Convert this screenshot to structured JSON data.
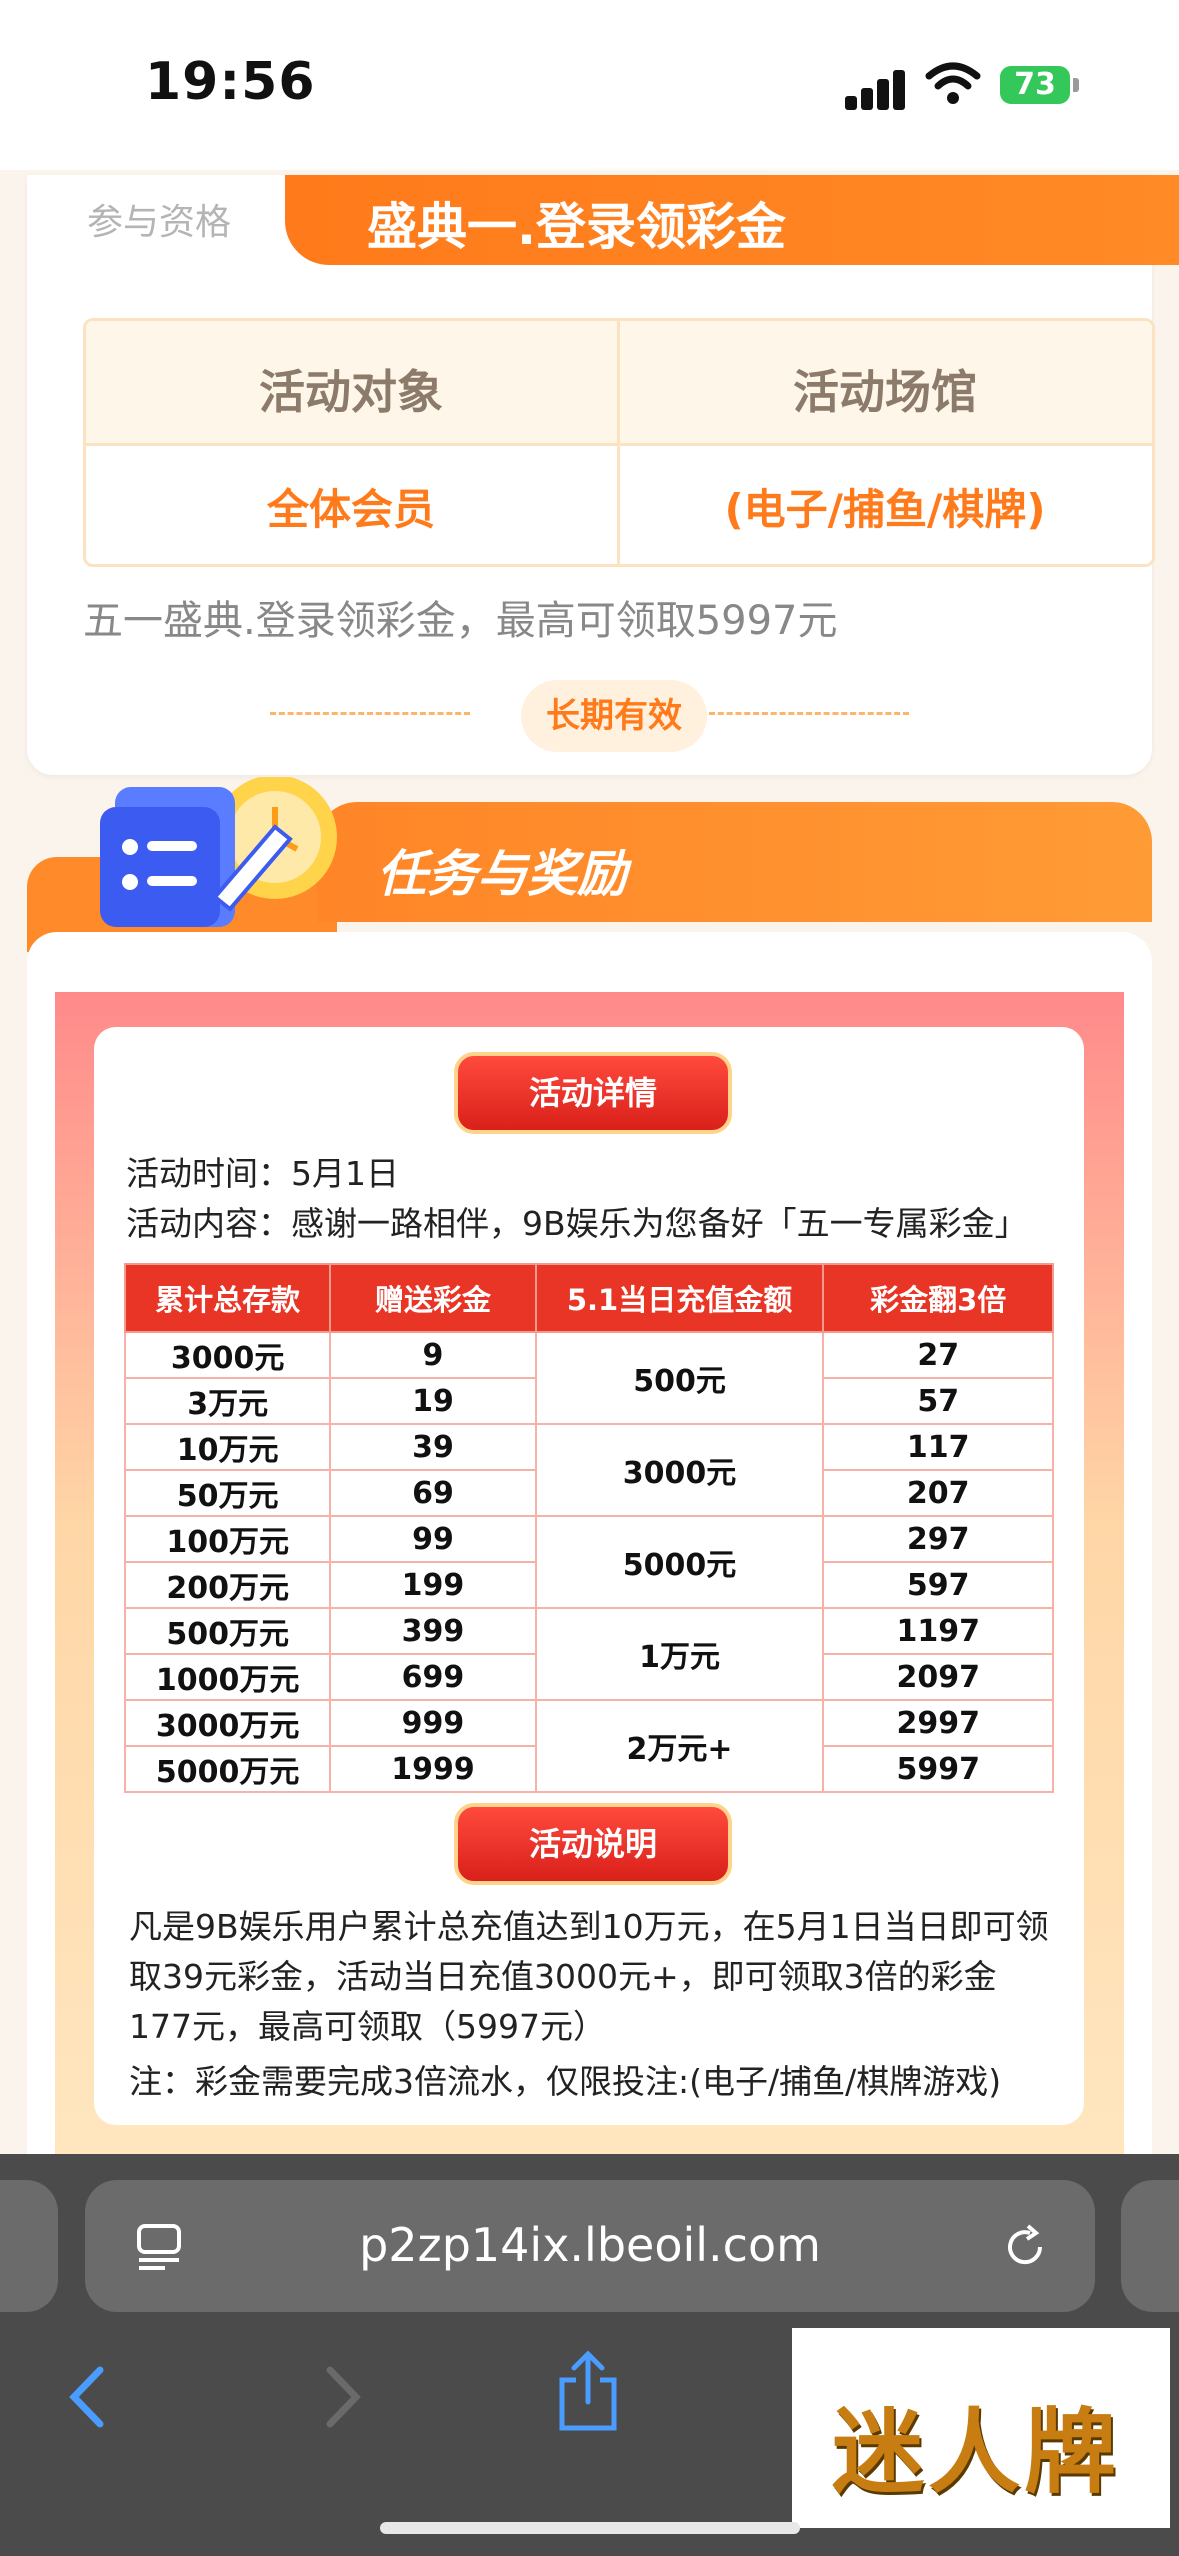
{
  "status": {
    "time": "19:56",
    "battery": "73"
  },
  "top_card": {
    "tab_label": "参与资格",
    "banner_title": "盛典一.登录领彩金",
    "table_headers": [
      "活动对象",
      "活动场馆"
    ],
    "table_values": [
      "全体会员",
      "(电子/捕鱼/棋牌)"
    ],
    "description": "五一盛典.登录领彩金，最高可领取5997元",
    "validity": "长期有效"
  },
  "task_section": {
    "title": "任务与奖励",
    "details_ribbon": "活动详情",
    "time_line": "活动时间：5月1日",
    "content_line": "活动内容：感谢一路相伴，9B娱乐为您备好「五一专属彩金」",
    "table": {
      "headers": [
        "累计总存款",
        "赠送彩金",
        "5.1当日充值金额",
        "彩金翻3倍"
      ],
      "deposits": [
        "3000元",
        "3万元",
        "10万元",
        "50万元",
        "100万元",
        "200万元",
        "500万元",
        "1000万元",
        "3000万元",
        "5000万元"
      ],
      "bonuses": [
        "9",
        "19",
        "39",
        "69",
        "99",
        "199",
        "399",
        "699",
        "999",
        "1999"
      ],
      "recharge": [
        "500元",
        "3000元",
        "5000元",
        "1万元",
        "2万元+"
      ],
      "triple": [
        "27",
        "57",
        "117",
        "207",
        "297",
        "597",
        "1197",
        "2097",
        "2997",
        "5997"
      ]
    },
    "explain_ribbon": "活动说明",
    "explain_text": "凡是9B娱乐用户累计总充值达到10万元，在5月1日当日即可领取39元彩金，活动当日充值3000元+，即可领取3倍的彩金177元，最高可领取（5997元）",
    "note_text": "注：彩金需要完成3倍流水，仅限投注:(电子/捕鱼/棋牌游戏)"
  },
  "browser": {
    "url": "p2zp14ix.lbeoil.com",
    "watermark": "迷人牌"
  }
}
